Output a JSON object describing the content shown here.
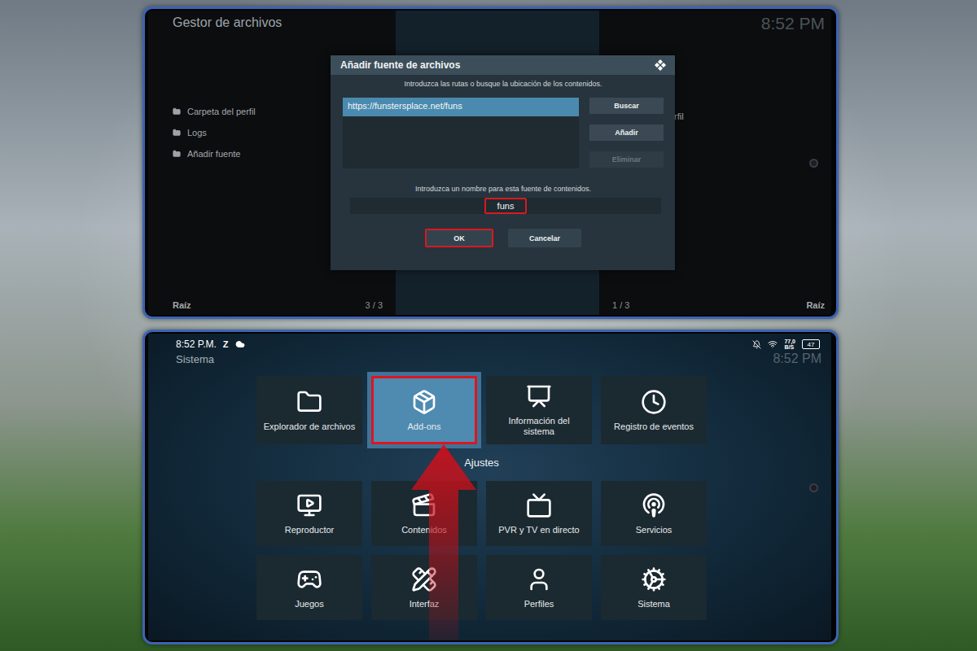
{
  "top_screen": {
    "title": "Gestor de archivos",
    "clock": "8:52 PM",
    "left_list": [
      {
        "label": "Carpeta del perfil"
      },
      {
        "label": "Logs"
      },
      {
        "label": "Añadir fuente"
      }
    ],
    "right_list": [
      {
        "label": "rfil"
      }
    ],
    "left_footer": {
      "path": "Raíz",
      "count": "3 / 3"
    },
    "right_footer": {
      "count": "1 / 3",
      "path": "Raíz"
    }
  },
  "dialog": {
    "title": "Añadir fuente de archivos",
    "paths_prompt": "Introduzca las rutas o busque la ubicación de los contenidos.",
    "paths": [
      {
        "label": "https://funstersplace.net/funs",
        "selected": true
      }
    ],
    "side_buttons": [
      {
        "label": "Buscar",
        "disabled": false
      },
      {
        "label": "Añadir",
        "disabled": false
      },
      {
        "label": "Eliminar",
        "disabled": true
      }
    ],
    "name_prompt": "Introduzca un nombre para esta fuente de contenidos.",
    "name_value": "funs",
    "name_marked": true,
    "buttons": [
      {
        "label": "OK",
        "marked": true
      },
      {
        "label": "Cancelar",
        "marked": false
      }
    ]
  },
  "bottom_screen": {
    "status_bar": {
      "time": "8:52 P.M.",
      "app_badge": "Z",
      "speed": "77,0",
      "speed_unit": "B/S",
      "battery": "47"
    },
    "title": "Sistema",
    "clock": "8:52 PM",
    "top_tiles": [
      {
        "label": "Explorador de archivos",
        "selected": false,
        "marked": false
      },
      {
        "label": "Add-ons",
        "selected": true,
        "marked": true
      },
      {
        "label": "Información del sistema",
        "selected": false,
        "marked": false
      },
      {
        "label": "Registro de eventos",
        "selected": false,
        "marked": false
      }
    ],
    "section_label": "Ajustes",
    "settings_tiles": [
      {
        "label": "Reproductor",
        "selected": false
      },
      {
        "label": "Contenidos",
        "selected": false
      },
      {
        "label": "PVR y TV en directo",
        "selected": false
      },
      {
        "label": "Servicios",
        "selected": false
      },
      {
        "label": "Juegos",
        "selected": false
      },
      {
        "label": "Interfaz",
        "selected": false
      },
      {
        "label": "Perfiles",
        "selected": false
      },
      {
        "label": "Sistema",
        "selected": false
      }
    ]
  }
}
